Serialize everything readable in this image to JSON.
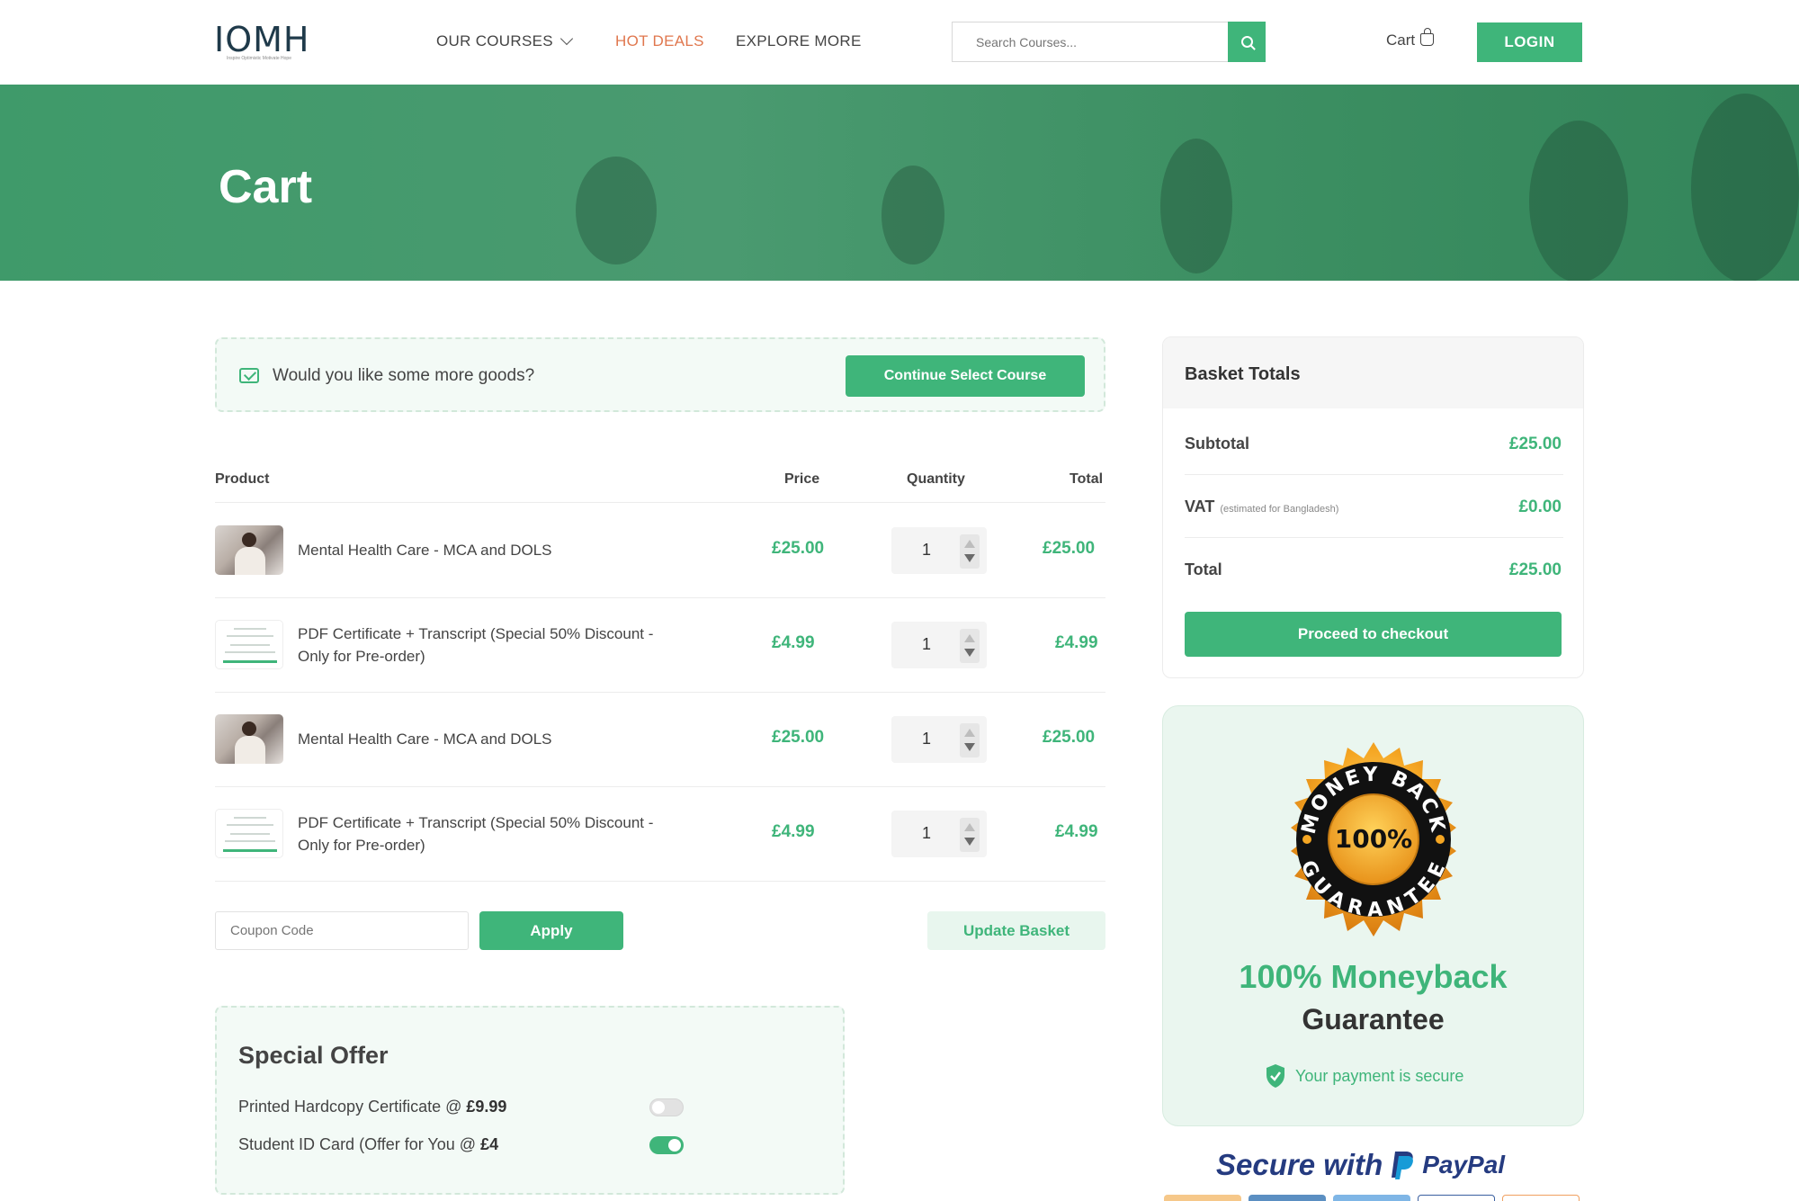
{
  "header": {
    "logo_text": "IOMH",
    "logo_tagline": "Inspire Optimistic Motivate Hope",
    "nav": {
      "courses": "OUR COURSES",
      "deals": "HOT DEALS",
      "explore": "EXPLORE MORE"
    },
    "search_placeholder": "Search Courses...",
    "cart_label": "Cart",
    "login_label": "LOGIN"
  },
  "hero": {
    "title": "Cart"
  },
  "prompt": {
    "text": "Would you like some more goods?",
    "button": "Continue Select Course"
  },
  "table": {
    "headers": {
      "product": "Product",
      "price": "Price",
      "quantity": "Quantity",
      "total": "Total"
    },
    "rows": [
      {
        "name": "Mental Health Care - MCA and DOLS",
        "price": "£25.00",
        "quantity": "1",
        "total": "£25.00"
      },
      {
        "name": "PDF Certificate + Transcript (Special 50% Discount - Only for Pre-order)",
        "price": "£4.99",
        "quantity": "1",
        "total": "£4.99"
      },
      {
        "name": "Mental Health Care - MCA and DOLS",
        "price": "£25.00",
        "quantity": "1",
        "total": "£25.00"
      },
      {
        "name": "PDF Certificate + Transcript (Special 50% Discount - Only for Pre-order)",
        "price": "£4.99",
        "quantity": "1",
        "total": "£4.99"
      }
    ]
  },
  "coupon": {
    "placeholder": "Coupon Code",
    "apply": "Apply",
    "update": "Update Basket"
  },
  "offer": {
    "title": "Special Offer",
    "items": [
      {
        "label": "Printed Hardcopy Certificate @ ",
        "price": "£9.99",
        "enabled": false
      },
      {
        "label": "Student ID Card (Offer for You @ ",
        "price": "£4",
        "enabled": true
      }
    ]
  },
  "basket": {
    "title": "Basket Totals",
    "subtotal_label": "Subtotal",
    "subtotal": "£25.00",
    "vat_label": "VAT",
    "vat_note": "(estimated for Bangladesh)",
    "vat": "£0.00",
    "total_label": "Total",
    "total": "£25.00",
    "checkout": "Proceed to checkout"
  },
  "guarantee": {
    "badge_top": "MONEY BACK",
    "badge_center": "100%",
    "badge_bottom": "GUARANTEE",
    "title": "100% Moneyback",
    "subtitle": "Guarantee",
    "secure": "Your payment is secure"
  },
  "paypal": {
    "secure_with": "Secure with",
    "brand": "PayPal"
  },
  "colors": {
    "accent": "#3fb57a",
    "deals": "#e0774e",
    "text": "#444444"
  }
}
